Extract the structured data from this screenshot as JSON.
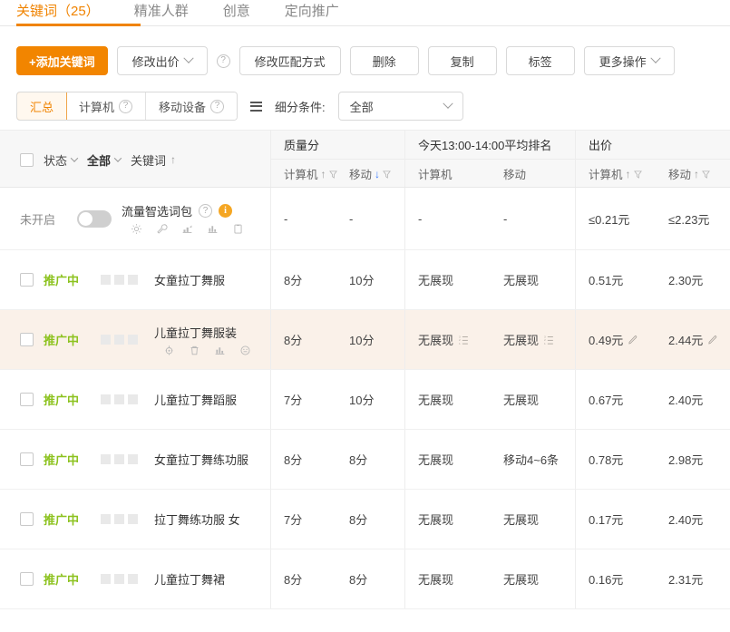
{
  "tabs": [
    {
      "label": "关键词（25）",
      "active": true
    },
    {
      "label": "精准人群",
      "active": false
    },
    {
      "label": "创意",
      "active": false
    },
    {
      "label": "定向推广",
      "active": false
    }
  ],
  "toolbar": {
    "add_keyword": "+添加关键词",
    "modify_bid": "修改出价",
    "help_icon": "?",
    "modify_match": "修改匹配方式",
    "delete": "删除",
    "copy": "复制",
    "tag": "标签",
    "more_actions": "更多操作"
  },
  "filterbar": {
    "segments": [
      {
        "label": "汇总",
        "active": true,
        "help": false
      },
      {
        "label": "计算机",
        "active": false,
        "help": true
      },
      {
        "label": "移动设备",
        "active": false,
        "help": true
      }
    ],
    "subdivision_label": "细分条件:",
    "subdivision_value": "全部"
  },
  "table": {
    "header": {
      "status_label": "状态",
      "all_label": "全部",
      "keyword_label": "关键词",
      "keyword_sort": "↑",
      "groups": [
        {
          "title": "质量分",
          "subs": [
            {
              "label": "计算机",
              "sort": "↑",
              "sort_dir": "up",
              "funnel": true
            },
            {
              "label": "移动",
              "sort": "↓",
              "sort_dir": "down",
              "funnel": true
            }
          ]
        },
        {
          "title": "今天13:00-14:00平均排名",
          "subs": [
            {
              "label": "计算机",
              "sort": "",
              "sort_dir": "",
              "funnel": false
            },
            {
              "label": "移动",
              "sort": "",
              "sort_dir": "",
              "funnel": false
            }
          ]
        },
        {
          "title": "出价",
          "subs": [
            {
              "label": "计算机",
              "sort": "↑",
              "sort_dir": "up",
              "funnel": true
            },
            {
              "label": "移动",
              "sort": "↑",
              "sort_dir": "up",
              "funnel": true
            }
          ]
        }
      ]
    },
    "rows": [
      {
        "type": "toggle",
        "status": "未开启",
        "keyword": "流量智选词包",
        "help_icon": "?",
        "info_icon": "i",
        "icons": [
          "gear-icon",
          "wrench-icon",
          "chart-up-icon",
          "bar-chart-icon",
          "clipboard-icon"
        ],
        "qs_pc": "-",
        "qs_mobile": "-",
        "rank_pc": "-",
        "rank_mobile": "-",
        "bid_pc": "≤0.21元",
        "bid_mobile": "≤2.23元",
        "hover": false
      },
      {
        "type": "keyword",
        "status": "推广中",
        "keyword": "女童拉丁舞服",
        "qs_pc": "8分",
        "qs_mobile": "10分",
        "rank_pc": "无展现",
        "rank_mobile": "无展现",
        "bid_pc": "0.51元",
        "bid_mobile": "2.30元",
        "hover": false
      },
      {
        "type": "keyword",
        "status": "推广中",
        "keyword": "儿童拉丁舞服装",
        "icons": [
          "target-icon",
          "trash-icon",
          "bar-chart-icon",
          "emoji-icon"
        ],
        "qs_pc": "8分",
        "qs_mobile": "10分",
        "rank_pc": "无展现",
        "rank_mobile": "无展现",
        "bid_pc": "0.49元",
        "bid_mobile": "2.44元",
        "hover": true
      },
      {
        "type": "keyword",
        "status": "推广中",
        "keyword": "儿童拉丁舞蹈服",
        "qs_pc": "7分",
        "qs_mobile": "10分",
        "rank_pc": "无展现",
        "rank_mobile": "无展现",
        "bid_pc": "0.67元",
        "bid_mobile": "2.40元",
        "hover": false
      },
      {
        "type": "keyword",
        "status": "推广中",
        "keyword": "女童拉丁舞练功服",
        "qs_pc": "8分",
        "qs_mobile": "8分",
        "rank_pc": "无展现",
        "rank_mobile": "移动4~6条",
        "bid_pc": "0.78元",
        "bid_mobile": "2.98元",
        "hover": false
      },
      {
        "type": "keyword",
        "status": "推广中",
        "keyword": "拉丁舞练功服 女",
        "qs_pc": "7分",
        "qs_mobile": "8分",
        "rank_pc": "无展现",
        "rank_mobile": "无展现",
        "bid_pc": "0.17元",
        "bid_mobile": "2.40元",
        "hover": false
      },
      {
        "type": "keyword",
        "status": "推广中",
        "keyword": "儿童拉丁舞裙",
        "qs_pc": "8分",
        "qs_mobile": "8分",
        "rank_pc": "无展现",
        "rank_mobile": "无展现",
        "bid_pc": "0.16元",
        "bid_mobile": "2.31元",
        "hover": false
      }
    ]
  },
  "colors": {
    "accent_orange": "#f28500",
    "status_green": "#8cc21e",
    "info_orange": "#f5a623",
    "sort_blue": "#3a7afe"
  }
}
